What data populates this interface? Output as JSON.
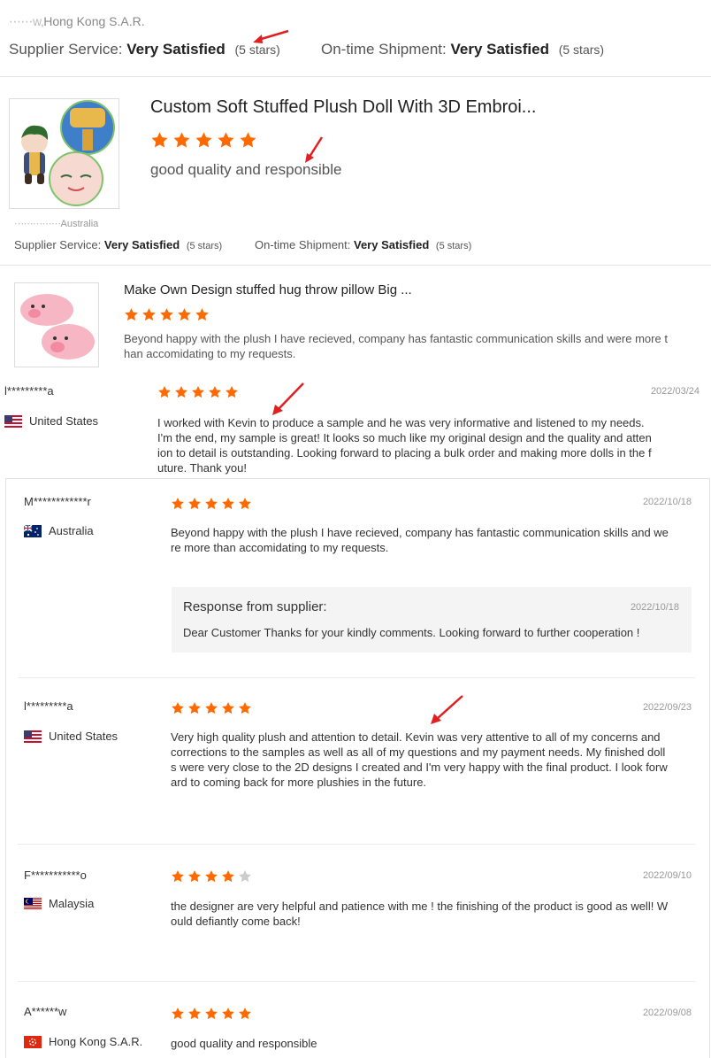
{
  "colors": {
    "star": "#ff6a00",
    "star_empty": "#cccccc",
    "arrow": "#e02020"
  },
  "top_review": {
    "location": "Hong Kong S.A.R.",
    "supplier_service_label": "Supplier Service:",
    "supplier_service_value": "Very Satisfied",
    "supplier_service_stars": "(5 stars)",
    "shipment_label": "On-time Shipment:",
    "shipment_value": "Very Satisfied",
    "shipment_stars": "(5 stars)"
  },
  "product_review_1": {
    "title": "Custom Soft Stuffed Plush Doll With 3D Embroi...",
    "rating": 5,
    "comment": "good quality and responsible",
    "reviewer_location": "Australia",
    "supplier_service_label": "Supplier Service:",
    "supplier_service_value": "Very Satisfied",
    "supplier_service_stars": "(5 stars)",
    "shipment_label": "On-time Shipment:",
    "shipment_value": "Very Satisfied",
    "shipment_stars": "(5 stars)"
  },
  "product_review_2": {
    "title": "Make Own Design stuffed hug throw pillow Big ...",
    "rating": 5,
    "comment_line1": "Beyond happy with the plush I have recieved, company has fantastic communication skills and were more t",
    "comment_line2": "han accomidating to my requests."
  },
  "featured_review": {
    "name": "l*********a",
    "country": "United States",
    "date": "2022/03/24",
    "rating": 5,
    "lines": [
      "I worked with Kevin to produce a sample and he was very informative and listened to my needs.",
      "I'm the end, my sample is great! It looks so much like my original design and the quality and atten",
      "ion to detail is outstanding. Looking forward to placing a bulk order and making more dolls in the f",
      "uture. Thank you!"
    ]
  },
  "reviews": [
    {
      "name": "M************r",
      "country": "Australia",
      "date": "2022/10/18",
      "rating": 5,
      "lines": [
        "Beyond happy with the plush I have recieved, company has fantastic communication skills and we",
        "re more than accomidating to my requests."
      ],
      "response_title": "Response from supplier:",
      "response_date": "2022/10/18",
      "response_text": "Dear Customer Thanks for your kindly comments. Looking forward to further cooperation !"
    },
    {
      "name": "l*********a",
      "country": "United States",
      "date": "2022/09/23",
      "rating": 5,
      "lines": [
        "Very high quality plush and attention to detail. Kevin was very attentive to all of my concerns and",
        "corrections to the samples as well as all of my questions and my payment needs. My finished doll",
        "s were very close to the 2D designs I created and I'm very happy with the final product. I look forw",
        "ard to coming back for more plushies in the future."
      ]
    },
    {
      "name": "F***********o",
      "country": "Malaysia",
      "date": "2022/09/10",
      "rating": 4,
      "lines": [
        "the designer are very helpful and patience with me ! the finishing of the product is good as well! W",
        "ould defiantly come back!"
      ]
    },
    {
      "name": "A******w",
      "country": "Hong Kong S.A.R.",
      "date": "2022/09/08",
      "rating": 5,
      "lines": [
        "good quality and responsible"
      ]
    }
  ]
}
